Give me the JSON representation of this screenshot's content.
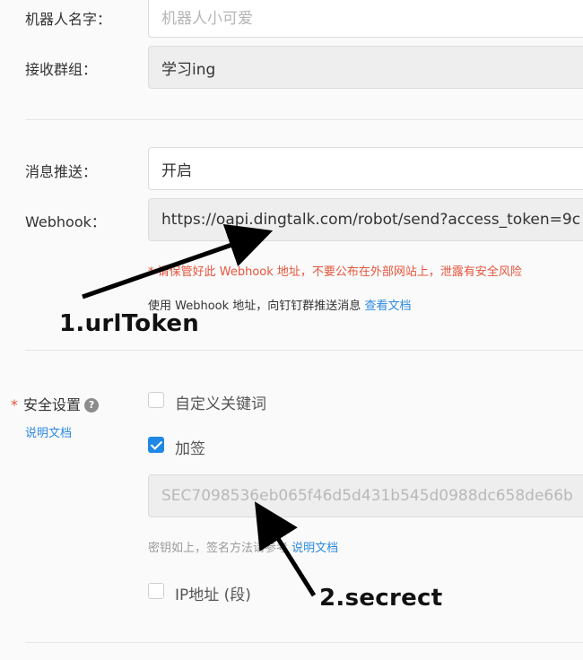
{
  "robot_name": {
    "label": "机器人名字：",
    "placeholder": "机器人小可爱"
  },
  "receive_group": {
    "label": "接收群组：",
    "value": "学习ing"
  },
  "message_push": {
    "label": "消息推送：",
    "value": "开启"
  },
  "webhook": {
    "label": "Webhook：",
    "value": "https://oapi.dingtalk.com/robot/send?access_token=9c",
    "warning": "* 请保管好此 Webhook 地址，不要公布在外部网站上，泄露有安全风险",
    "hint": "使用 Webhook 地址，向钉钉群推送消息",
    "hint_link": "查看文档"
  },
  "security": {
    "required_mark": "*",
    "label": "安全设置",
    "help_icon": "question-circle-icon",
    "doc_link": "说明文档",
    "custom_keywords": {
      "label": "自定义关键词",
      "checked": false
    },
    "signature": {
      "label": "加签",
      "checked": true
    },
    "secret_value": "SEC7098536eb065f46d5d431b545d0988dc658de66b",
    "secret_hint": "密钥如上，签名方法请参考",
    "secret_hint_link": "说明文档",
    "ip_range": {
      "label": "IP地址 (段)",
      "checked": false
    }
  },
  "annotations": {
    "url_token": "1.urlToken",
    "secret": "2.secrect"
  }
}
